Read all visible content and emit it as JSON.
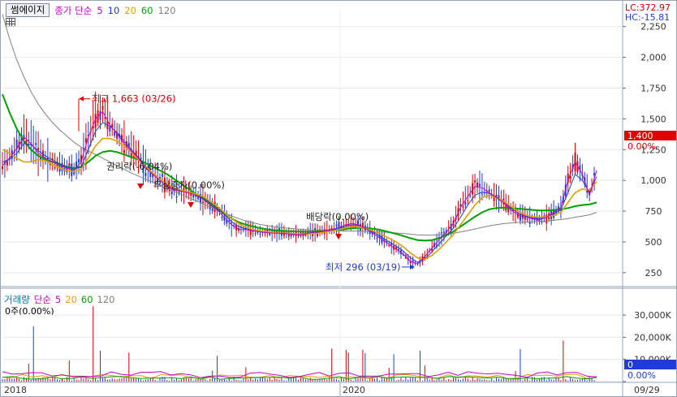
{
  "header": {
    "stock_name": "썸에이지",
    "ma_label": "종가 단순",
    "periods": [
      "5",
      "10",
      "20",
      "60",
      "120"
    ],
    "lc": "LC:372.97",
    "hc": "HC:-15.81"
  },
  "volume_header": {
    "label": "거래량",
    "ma_label": "단순",
    "periods": [
      "5",
      "20",
      "60",
      "120"
    ],
    "stat": "0주(0.00%)"
  },
  "colors": {
    "ma5": "#c800c8",
    "ma10": "#1f3cd6",
    "ma20": "#e0a000",
    "ma60": "#00a000",
    "ma120": "#808080",
    "up": "#e00000",
    "down": "#1f3cd6",
    "volume_label": "#0077aa"
  },
  "chart_data": [
    {
      "type": "line",
      "y_axis": {
        "ticks": [
          250,
          500,
          750,
          1000,
          1250,
          1500,
          1750,
          2000,
          2250
        ],
        "tick_labels": [
          "250",
          "500",
          "750",
          "1,000",
          "1,250",
          "1,500",
          "1,750",
          "2,000",
          "2,250"
        ],
        "ylim": [
          150,
          2380
        ]
      },
      "x_axis": {
        "labels": [
          "2018",
          "2020",
          "09/29"
        ]
      },
      "series": [
        {
          "name": "5",
          "values": [
            1120,
            1180,
            1260,
            1350,
            1300,
            1220,
            1180,
            1150,
            1120,
            1100,
            1080,
            1150,
            1350,
            1500,
            1560,
            1450,
            1380,
            1300,
            1240,
            1180,
            1100,
            1050,
            1000,
            950,
            920,
            910,
            900,
            880,
            850,
            800,
            760,
            700,
            640,
            600,
            600,
            590,
            580,
            575,
            570,
            570,
            565,
            560,
            560,
            575,
            580,
            590,
            600,
            620,
            640,
            650,
            630,
            600,
            560,
            520,
            480,
            440,
            400,
            340,
            320,
            380,
            450,
            520,
            580,
            650,
            780,
            870,
            950,
            940,
            900,
            860,
            820,
            760,
            720,
            700,
            690,
            680,
            700,
            740,
            780,
            1000,
            1150,
            1050,
            880,
            1080
          ]
        },
        {
          "name": "20",
          "values": [
            1250,
            1220,
            1180,
            1150,
            1150,
            1170,
            1160,
            1130,
            1100,
            1080,
            1070,
            1090,
            1180,
            1280,
            1340,
            1340,
            1320,
            1280,
            1230,
            1170,
            1110,
            1060,
            1010,
            970,
            940,
            920,
            905,
            890,
            870,
            830,
            790,
            740,
            690,
            650,
            620,
            600,
            590,
            580,
            575,
            572,
            568,
            565,
            563,
            566,
            570,
            578,
            588,
            600,
            615,
            625,
            620,
            605,
            585,
            560,
            530,
            500,
            460,
            410,
            370,
            360,
            390,
            440,
            500,
            560,
            640,
            720,
            800,
            860,
            880,
            860,
            830,
            790,
            750,
            720,
            705,
            700,
            705,
            715,
            740,
            820,
            900,
            930,
            920,
            990
          ]
        },
        {
          "name": "60",
          "values": [
            1700,
            1550,
            1420,
            1320,
            1250,
            1200,
            1170,
            1150,
            1130,
            1110,
            1100,
            1110,
            1150,
            1200,
            1230,
            1240,
            1230,
            1210,
            1190,
            1170,
            1140,
            1110,
            1080,
            1050,
            1010,
            970,
            930,
            890,
            850,
            810,
            770,
            730,
            690,
            660,
            640,
            625,
            612,
            602,
            595,
            590,
            587,
            585,
            584,
            584,
            585,
            588,
            592,
            598,
            605,
            612,
            615,
            612,
            605,
            595,
            580,
            565,
            548,
            530,
            515,
            510,
            515,
            530,
            555,
            585,
            625,
            665,
            705,
            740,
            765,
            775,
            778,
            775,
            770,
            765,
            760,
            755,
            755,
            758,
            765,
            775,
            790,
            800,
            805,
            820
          ]
        },
        {
          "name": "120",
          "values": [
            2350,
            2150,
            1980,
            1840,
            1720,
            1620,
            1540,
            1470,
            1410,
            1360,
            1310,
            1270,
            1240,
            1210,
            1180,
            1150,
            1120,
            1090,
            1060,
            1035,
            1010,
            985,
            960,
            935,
            910,
            885,
            860,
            835,
            810,
            785,
            760,
            735,
            710,
            690,
            670,
            655,
            642,
            632,
            623,
            616,
            610,
            605,
            601,
            598,
            596,
            594,
            592,
            590,
            589,
            588,
            587,
            585,
            583,
            580,
            576,
            572,
            568,
            563,
            558,
            555,
            555,
            558,
            563,
            570,
            580,
            592,
            605,
            618,
            630,
            640,
            648,
            654,
            658,
            661,
            664,
            667,
            670,
            675,
            682,
            690,
            700,
            710,
            720,
            740
          ]
        }
      ],
      "extra_series": [
        {
          "name": "10",
          "values": [
            1150,
            1170,
            1220,
            1300,
            1290,
            1240,
            1200,
            1165,
            1135,
            1110,
            1090,
            1110,
            1250,
            1400,
            1470,
            1440,
            1390,
            1320,
            1250,
            1185,
            1115,
            1060,
            1010,
            965,
            930,
            915,
            902,
            888,
            862,
            820,
            775,
            720,
            665,
            625,
            605,
            595,
            585,
            578,
            572,
            570,
            567,
            562,
            561,
            570,
            576,
            585,
            595,
            610,
            628,
            640,
            628,
            604,
            572,
            537,
            500,
            465,
            425,
            370,
            335,
            360,
            420,
            485,
            548,
            612,
            700,
            800,
            880,
            905,
            895,
            865,
            826,
            775,
            735,
            710,
            697,
            690,
            700,
            728,
            760,
            900,
            1050,
            1000,
            900,
            1030
          ]
        }
      ],
      "annotations": [
        {
          "text": "최고 1,663 (03/26)",
          "value": 1663
        },
        {
          "text": "권리락(-6.04%)"
        },
        {
          "text": "무상증자(0.00%)"
        },
        {
          "text": "배당락(0.00%)"
        },
        {
          "text": "최저 296 (03/19)",
          "value": 296
        }
      ],
      "price_badge": {
        "price": "1,400",
        "change": "0.00%"
      }
    },
    {
      "type": "bar",
      "y_axis": {
        "ticks": [
          0,
          10000,
          20000,
          30000
        ],
        "tick_labels": [
          "",
          "10,000K",
          "20,000K",
          "30,000K"
        ],
        "ylim": [
          0,
          37000
        ]
      },
      "volume_badge": {
        "value": "0",
        "change": "0.00%"
      }
    }
  ]
}
